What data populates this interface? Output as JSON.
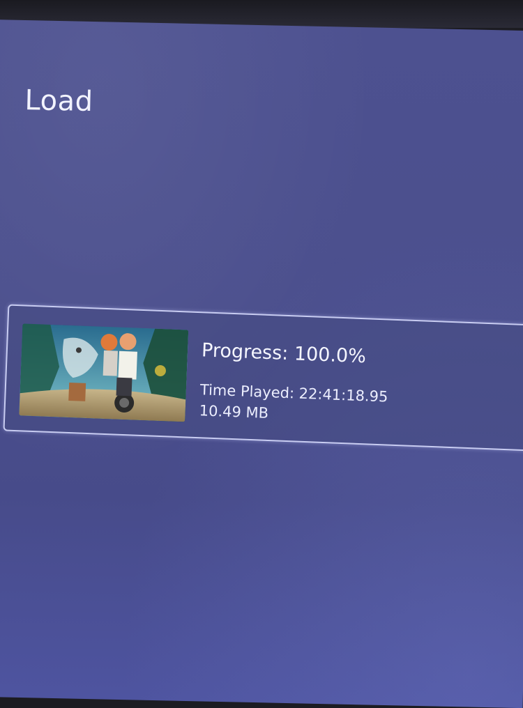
{
  "header": {
    "title": "Load"
  },
  "save_slot": {
    "progress_label": "Progress: 100.0%",
    "progress_value": 100.0,
    "time_played_label": "Time Played: 22:41:18.95",
    "size_label": "10.49 MB"
  },
  "colors": {
    "background": "#4b4f8d",
    "card_border": "#c9cdf2",
    "text": "#f2f3ff"
  }
}
